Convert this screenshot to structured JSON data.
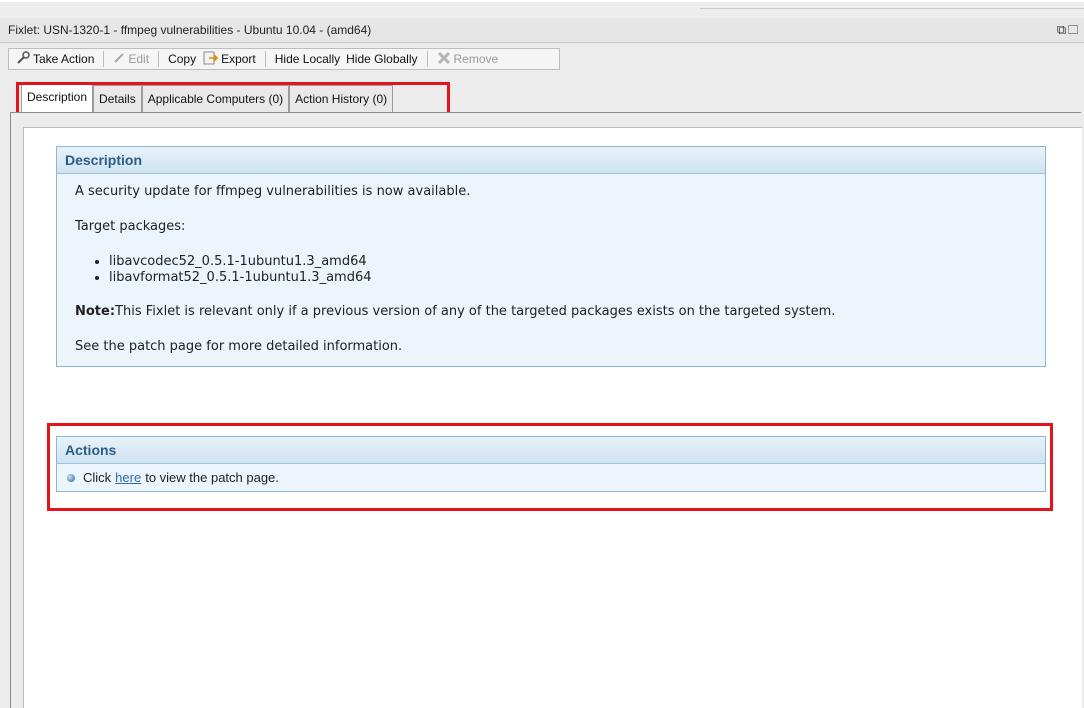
{
  "window": {
    "title": "Fixlet: USN-1320-1 - ffmpeg vulnerabilities - Ubuntu 10.04 - (amd64)",
    "window_icons": "⧉☐"
  },
  "toolbar": {
    "take_action": "Take Action",
    "edit": "Edit",
    "copy": "Copy",
    "export": "Export",
    "hide_locally": "Hide Locally",
    "hide_globally": "Hide Globally",
    "remove": "Remove"
  },
  "tabs": [
    {
      "label": "Description"
    },
    {
      "label": "Details"
    },
    {
      "label": "Applicable Computers (0)"
    },
    {
      "label": "Action History (0)"
    }
  ],
  "description": {
    "header": "Description",
    "intro": "A security update for ffmpeg vulnerabilities is now available.",
    "target_label": "Target packages:",
    "packages": [
      "libavcodec52_0.5.1-1ubuntu1.3_amd64",
      "libavformat52_0.5.1-1ubuntu1.3_amd64"
    ],
    "note_label": "Note:",
    "note_text": "This Fixlet is relevant only if a previous version of any of the targeted packages exists on the targeted system.",
    "see_more": "See the patch page for more detailed information."
  },
  "actions": {
    "header": "Actions",
    "click_prefix": "Click",
    "link_text": "here",
    "click_suffix": "to view the patch page."
  },
  "colors": {
    "highlight": "#e3121b",
    "panel_header_text": "#2b5e86",
    "link": "#2a6db5"
  }
}
